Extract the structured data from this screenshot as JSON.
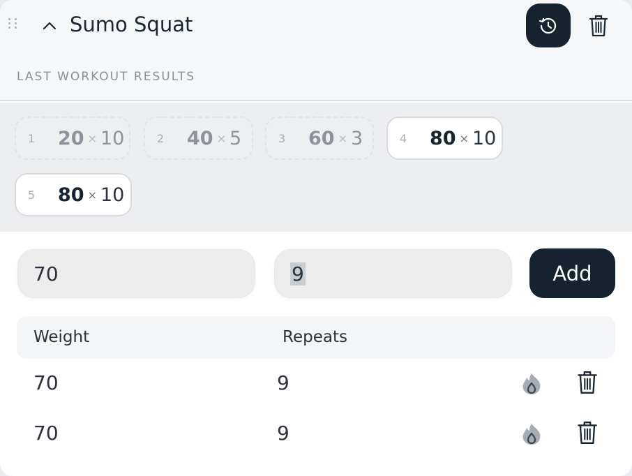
{
  "exercise": {
    "title": "Sumo Squat",
    "icons": {
      "drag": "drag-handle-icon",
      "collapse": "chevron-up-icon",
      "history": "history-icon",
      "delete": "trash-icon"
    },
    "colors": {
      "dark_accent": "#14232f",
      "header_bg": "#f5f7f9",
      "results_bg": "#edeef0"
    }
  },
  "last_results": {
    "label": "LAST WORKOUT RESULTS",
    "sets": [
      {
        "index": "1",
        "weight": "20",
        "sep": "×",
        "reps": "10",
        "state": "past"
      },
      {
        "index": "2",
        "weight": "40",
        "sep": "×",
        "reps": "5",
        "state": "past"
      },
      {
        "index": "3",
        "weight": "60",
        "sep": "×",
        "reps": "3",
        "state": "past"
      },
      {
        "index": "4",
        "weight": "80",
        "sep": "×",
        "reps": "10",
        "state": "current"
      },
      {
        "index": "5",
        "weight": "80",
        "sep": "×",
        "reps": "10",
        "state": "current"
      }
    ]
  },
  "entry": {
    "weight_value": "70",
    "reps_value": "9",
    "add_label": "Add"
  },
  "table": {
    "headers": {
      "weight": "Weight",
      "reps": "Repeats"
    },
    "rows": [
      {
        "weight": "70",
        "reps": "9",
        "icons": [
          "flame-icon",
          "trash-icon"
        ]
      },
      {
        "weight": "70",
        "reps": "9",
        "icons": [
          "flame-icon",
          "trash-icon"
        ]
      }
    ]
  }
}
